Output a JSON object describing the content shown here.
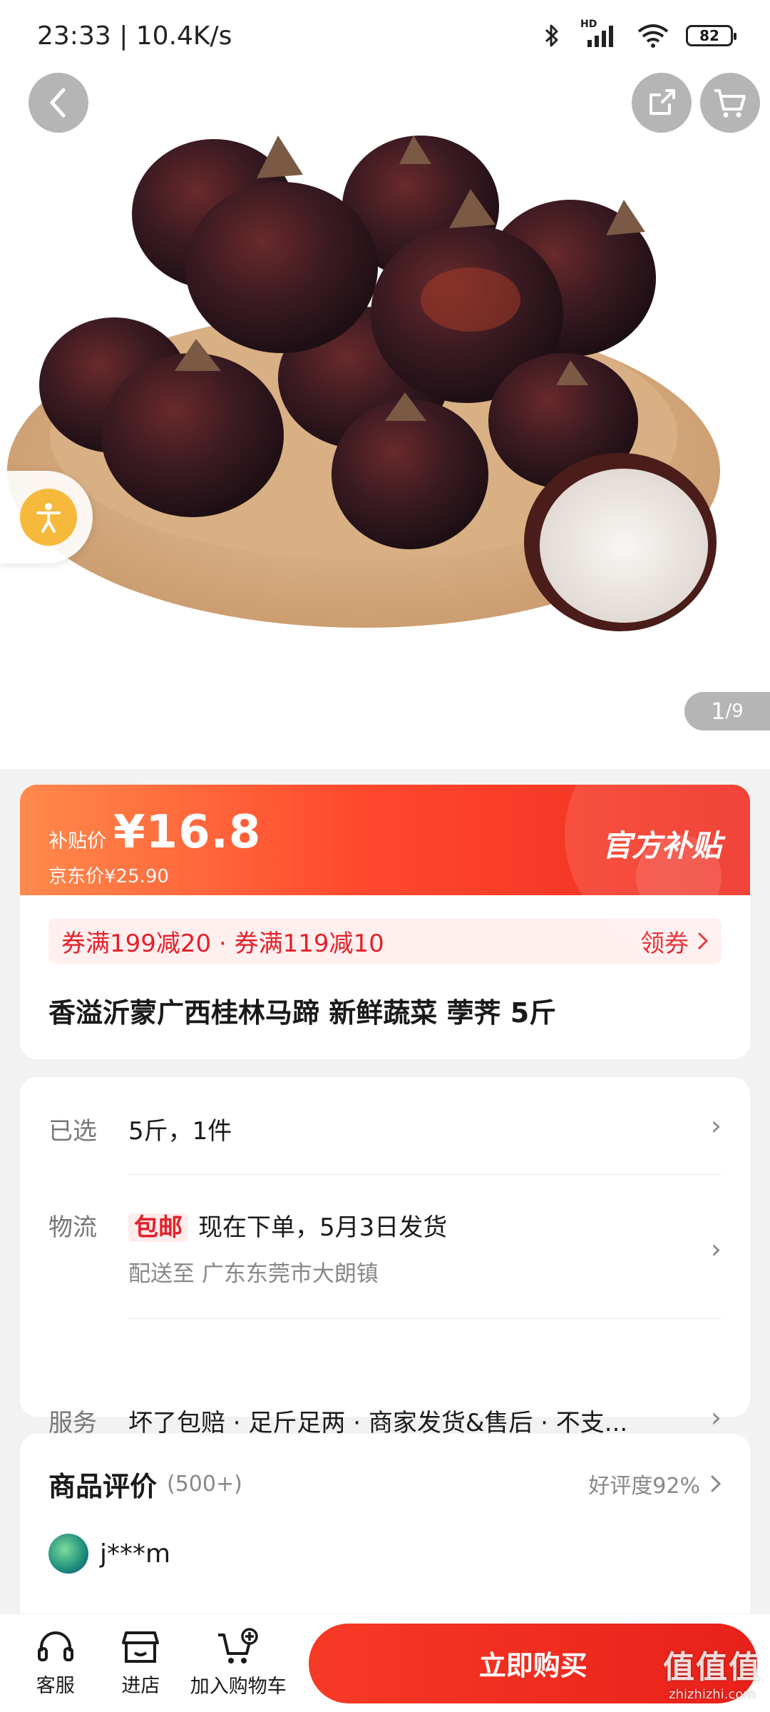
{
  "status_bar": {
    "time_speed": "23:33 | 10.4K/s",
    "battery": "82",
    "network_badge": "HD"
  },
  "gallery": {
    "current": "1",
    "total": "/9"
  },
  "price": {
    "subsidy_label": "补贴价",
    "subsidy_value": "¥16.8",
    "jd_price": "京东价¥25.90",
    "official_tag": "官方补贴"
  },
  "coupon": {
    "text": "券满199减20 · 券满119减10",
    "action": "领券"
  },
  "product": {
    "title": "香溢沂蒙广西桂林马蹄 新鲜蔬菜 荸荠 5斤"
  },
  "info": {
    "selected_key": "已选",
    "selected_val": "5斤，1件",
    "logistics_key": "物流",
    "free_ship": "包邮",
    "ship_text": "现在下单，5月3日发货",
    "deliver_to": "配送至   广东东莞市大朗镇",
    "service_key": "服务",
    "service_val": "坏了包赔 · 足斤足两 · 商家发货&售后 · 不支..."
  },
  "reviews": {
    "title": "商品评价",
    "count": "(500+)",
    "rating": "好评度92%",
    "first_user": "j***m"
  },
  "bottom_bar": {
    "service": "客服",
    "shop": "进店",
    "cart": "加入购物车",
    "buy": "立即购买"
  },
  "watermark": {
    "big": "值值值",
    "small": "zhizhizhi.com"
  },
  "colors": {
    "accent": "#e4202a",
    "banner_start": "#ff8a4c",
    "banner_end": "#ef2a1e"
  }
}
